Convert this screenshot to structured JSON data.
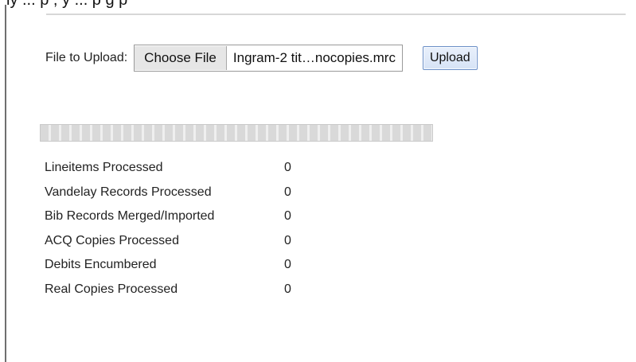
{
  "header": {
    "cropped_text": "ly       ...     p         ,  y                  ...     p   g        p"
  },
  "upload": {
    "label": "File to Upload:",
    "choose_button": "Choose File",
    "file_name": "Ingram-2 tit…nocopies.mrc",
    "upload_button": "Upload"
  },
  "progress": {
    "value": 0
  },
  "stats": [
    {
      "label": "Lineitems Processed",
      "value": "0"
    },
    {
      "label": "Vandelay Records Processed",
      "value": "0"
    },
    {
      "label": "Bib Records Merged/Imported",
      "value": "0"
    },
    {
      "label": "ACQ Copies Processed",
      "value": "0"
    },
    {
      "label": "Debits Encumbered",
      "value": "0"
    },
    {
      "label": "Real Copies Processed",
      "value": "0"
    }
  ]
}
